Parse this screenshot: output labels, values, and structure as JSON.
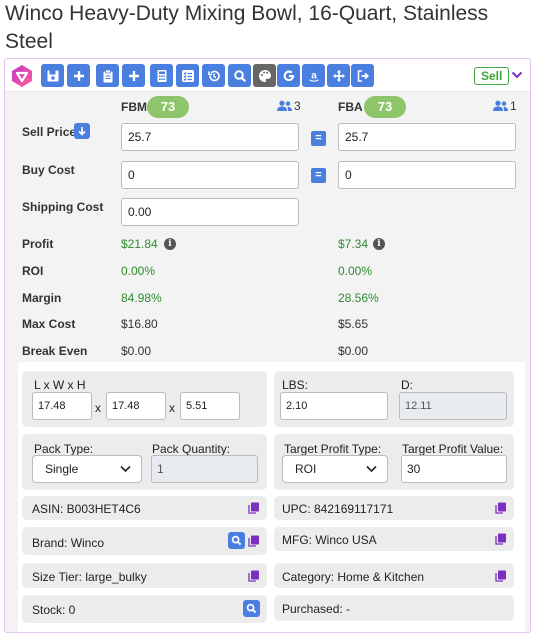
{
  "product": {
    "title": "Winco Heavy-Duty Mixing Bowl, 16-Quart, Stainless Steel"
  },
  "toolbar": {
    "sell_label": "Sell",
    "icons": [
      "save-icon",
      "plus-icon",
      "clipboard-icon",
      "plus-icon",
      "calculator-icon",
      "checklist-icon",
      "history-icon",
      "search-icon",
      "palette-icon",
      "google-icon",
      "amazon-icon",
      "arrows-icon",
      "exit-icon"
    ],
    "accent": "#4a7fe0"
  },
  "fbm": {
    "header": "FBM",
    "score": "73",
    "sellers": "3",
    "sell_price": "25.7",
    "buy_cost": "0",
    "shipping_cost": "0.00",
    "profit": "$21.84",
    "roi": "0.00%",
    "margin": "84.98%",
    "max_cost": "$16.80",
    "break_even": "$0.00"
  },
  "fba": {
    "header": "FBA",
    "score": "73",
    "sellers": "1",
    "sell_price": "25.7",
    "buy_cost": "0",
    "profit": "$7.34",
    "roi": "0.00%",
    "margin": "28.56%",
    "max_cost": "$5.65",
    "break_even": "$0.00"
  },
  "labels": {
    "sell_price": "Sell Price",
    "buy_cost": "Buy Cost",
    "shipping_cost": "Shipping Cost",
    "profit": "Profit",
    "roi": "ROI",
    "margin": "Margin",
    "max_cost": "Max Cost",
    "break_even": "Break Even",
    "equals": "="
  },
  "dims": {
    "label": "L x W x H",
    "l": "17.48",
    "w": "17.48",
    "h": "5.51",
    "sep": "x"
  },
  "weight": {
    "lbs_label": "LBS:",
    "lbs": "2.10",
    "d_label": "D:",
    "d": "12.11"
  },
  "pack": {
    "type_label": "Pack Type:",
    "type": "Single",
    "qty_label": "Pack Quantity:",
    "qty": "1"
  },
  "target": {
    "type_label": "Target Profit Type:",
    "type": "ROI",
    "value_label": "Target Profit Value:",
    "value": "30"
  },
  "info": {
    "asin": "ASIN: B003HET4C6",
    "upc": "UPC: 842169117171",
    "brand": "Brand: Winco",
    "mfg": "MFG: Winco USA",
    "size_tier": "Size Tier: large_bulky",
    "category": "Category: Home & Kitchen",
    "stock": "Stock: 0",
    "purchased": "Purchased: -"
  },
  "colors": {
    "green": "#2e8b2e",
    "pill": "#8ec56a",
    "button": "#4a7fe0",
    "copy": "#7b2fbf"
  }
}
